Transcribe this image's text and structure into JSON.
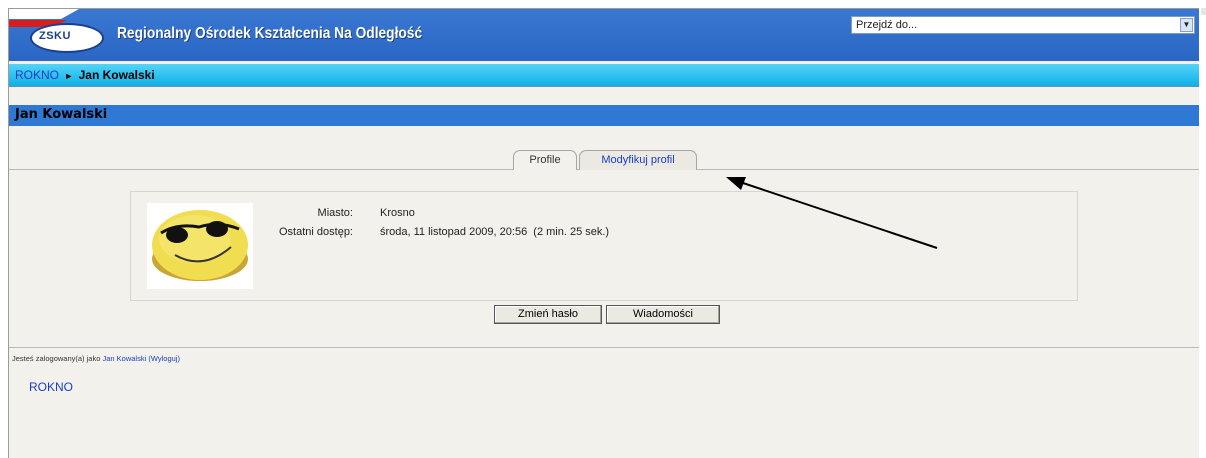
{
  "header": {
    "logo_text": "ZSKU",
    "site_title": "Regionalny Ośrodek Kształcenia Na Odległość",
    "jump_menu": {
      "selected": "Przejdź do..."
    }
  },
  "breadcrumb": {
    "home": "ROKNO",
    "separator": "►",
    "current": "Jan Kowalski"
  },
  "page": {
    "heading": "Jan Kowalski",
    "tabs": [
      {
        "label": "Profile"
      },
      {
        "label": "Modyfikuj profil"
      }
    ],
    "profile": {
      "city_label": "Miasto:",
      "city_value": "Krosno",
      "last_access_label": "Ostatni dostęp:",
      "last_access_value": "środa, 11 listopad 2009, 20:56  (2 min. 25 sek.)"
    },
    "buttons": {
      "change_password": "Zmień hasło",
      "messages": "Wiadomości"
    }
  },
  "footer": {
    "logged_in_prefix": "Jesteś zalogowany(a) jako ",
    "user_name": "Jan Kowalski",
    "logout": "(Wyloguj)",
    "home_link": "ROKNO"
  },
  "colors": {
    "header_blue": "#2a66c4",
    "navbar_cyan": "#0fb0e8",
    "heading_blue": "#2f78d4",
    "link_blue": "#1a3cc8",
    "page_bg": "#f3f1eb"
  }
}
